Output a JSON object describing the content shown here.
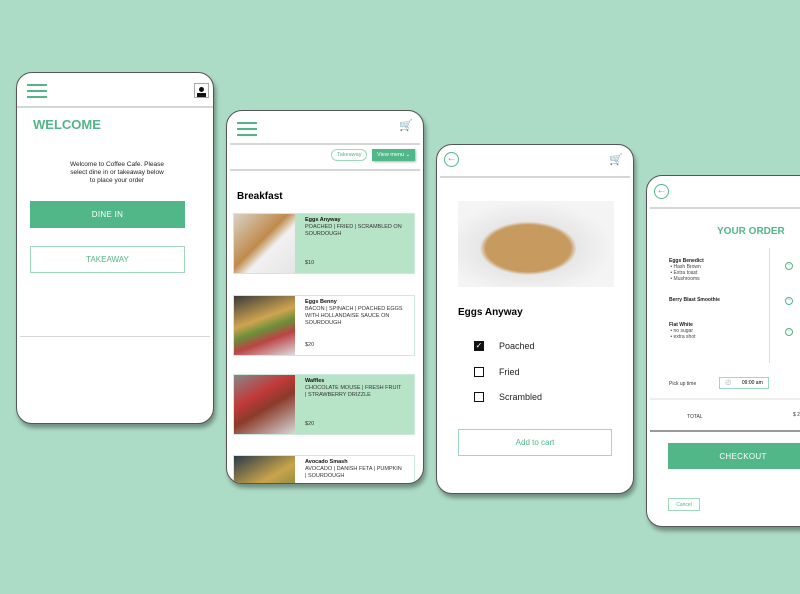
{
  "theme": {
    "accent": "#52b788",
    "accent_light": "#b7e4c7",
    "background": "#addcc6"
  },
  "screen1": {
    "title": "WELCOME",
    "intro": "Welcome to Coffee Cafe. Please select dine in or takeaway below to place your order",
    "dine_in": "DINE IN",
    "takeaway": "TAKEAWAY"
  },
  "screen2": {
    "filter_pill": "Takeaway",
    "view_menu": "View menu",
    "section": "Breakfast",
    "items": [
      {
        "name": "Eggs Anyway",
        "desc": "POACHED | FRIED | SCRAMBLED ON SOURDOUGH",
        "price": "$10",
        "highlighted": true
      },
      {
        "name": "Eggs Benny",
        "desc": "BACON | SPINACH | POACHED EGGS WITH HOLLANDAISE SAUCE ON SOURDOUGH",
        "price": "$20",
        "highlighted": false
      },
      {
        "name": "Waffles",
        "desc": "CHOCOLATE MOUSE | FRESH FRUIT | STRAWBERRY DRIZZLE",
        "price": "$20",
        "highlighted": true
      },
      {
        "name": "Avocado Smash",
        "desc": "AVOCADO | DANISH FETA | PUMPKIN | SOURDOUGH",
        "price": "",
        "highlighted": false
      }
    ]
  },
  "screen3": {
    "title": "Eggs Anyway",
    "options": [
      {
        "label": "Poached",
        "checked": true
      },
      {
        "label": "Fried",
        "checked": false
      },
      {
        "label": "Scrambled",
        "checked": false
      }
    ],
    "add_to_cart": "Add to cart"
  },
  "screen4": {
    "title": "YOUR ORDER",
    "items": [
      {
        "name": "Eggs Benedict",
        "extras": [
          "Hash Brown",
          "Extra toast",
          "Mushrooms"
        ]
      },
      {
        "name": "Berry Blast Smoothie",
        "extras": []
      },
      {
        "name": "Flat White",
        "extras": [
          "no sugar",
          "extra shot"
        ]
      }
    ],
    "pickup_label": "Pick up time",
    "pickup_time": "09:00 am",
    "total_label": "TOTAL",
    "total_value": "$ 2",
    "checkout": "CHECKOUT",
    "cancel": "Cancel"
  }
}
